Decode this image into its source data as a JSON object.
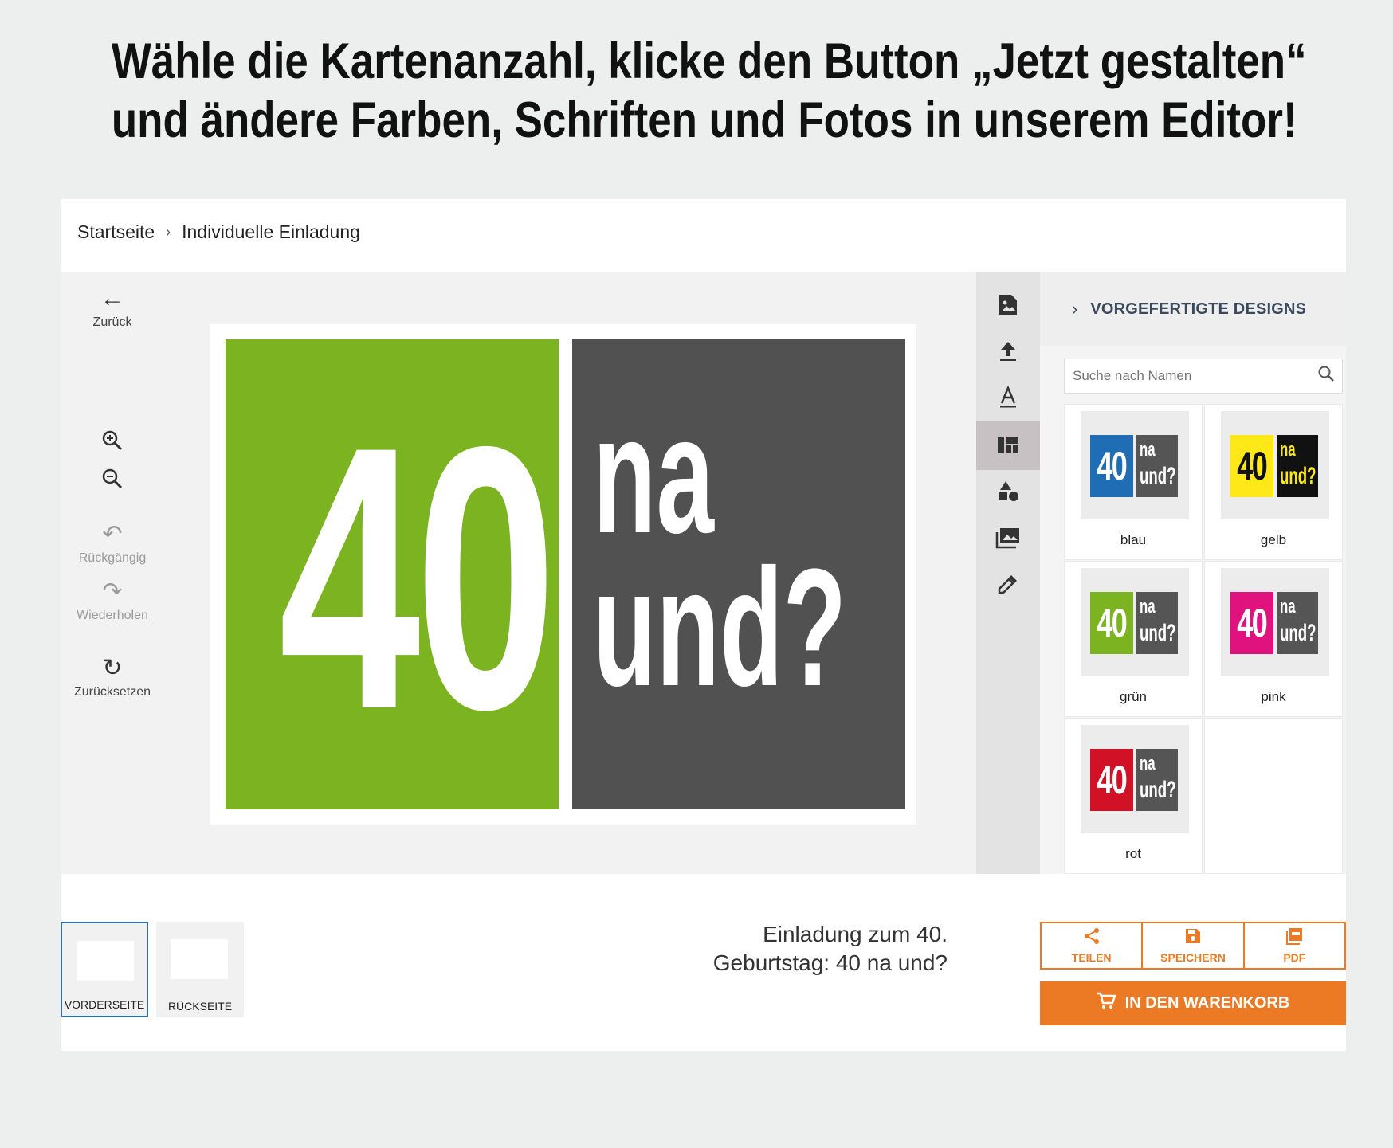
{
  "headline": {
    "line1": "Wähle die Kartenanzahl, klicke den Button „Jetzt gestalten“",
    "line2": "und ändere Farben, Schriften und Fotos in unserem Editor!"
  },
  "breadcrumb": {
    "home": "Startseite",
    "separator": "›",
    "current": "Individuelle Einladung"
  },
  "left_tools": {
    "back": "Zurück",
    "undo": "Rückgängig",
    "redo": "Wiederholen",
    "reset": "Zurücksetzen"
  },
  "canvas": {
    "number": "40",
    "line1": "na",
    "line2": "und?",
    "left_color": "#7cb321",
    "right_color": "#525151"
  },
  "icon_bar": [
    "image-edit-icon",
    "upload-icon",
    "text-icon",
    "layout-icon",
    "shapes-icon",
    "photos-icon",
    "eyedropper-icon"
  ],
  "side_panel": {
    "title": "VORGEFERTIGTE DESIGNS",
    "search_placeholder": "Suche nach Namen",
    "designs": [
      {
        "name": "blau",
        "color": "#1e6db5",
        "num": "40",
        "na": "na",
        "und": "und?"
      },
      {
        "name": "gelb",
        "color": "#ffe817",
        "num": "40",
        "na": "na",
        "und": "und?"
      },
      {
        "name": "grün",
        "color": "#7cb321",
        "num": "40",
        "na": "na",
        "und": "und?"
      },
      {
        "name": "pink",
        "color": "#e0127d",
        "num": "40",
        "na": "na",
        "und": "und?"
      },
      {
        "name": "rot",
        "color": "#d11226",
        "num": "40",
        "na": "na",
        "und": "und?"
      }
    ]
  },
  "pages": {
    "front": "VORDERSEITE",
    "back": "RÜCKSEITE"
  },
  "product_title": {
    "line1": "Einladung zum 40.",
    "line2": "Geburtstag: 40 na und?"
  },
  "actions": {
    "share": "TEILEN",
    "save": "SPEICHERN",
    "pdf": "PDF",
    "cart": "IN DEN WARENKORB"
  },
  "colors": {
    "accent": "#ec7a24",
    "active_page_border": "#2d6fb3"
  }
}
